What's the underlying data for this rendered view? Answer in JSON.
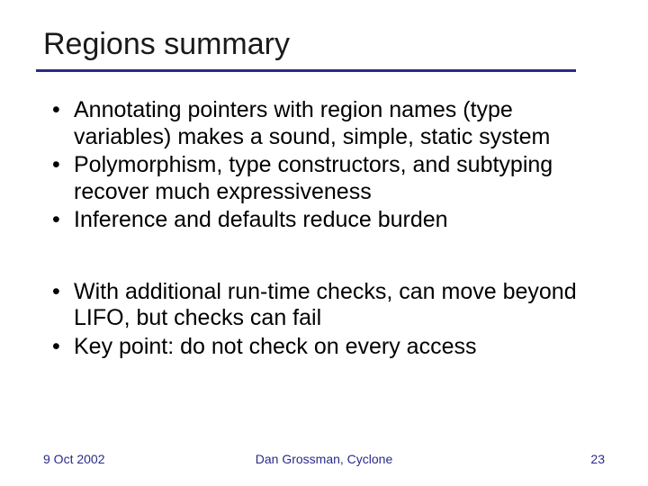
{
  "title": "Regions summary",
  "bullets_a": [
    "Annotating pointers with region names (type variables) makes a sound, simple, static system",
    "Polymorphism, type constructors, and subtyping recover much expressiveness",
    "Inference and defaults reduce burden"
  ],
  "bullets_b": [
    "With additional run-time checks, can move beyond LIFO, but checks can fail",
    "Key point: do not check on every access"
  ],
  "footer": {
    "date": "9 Oct 2002",
    "author": "Dan Grossman, Cyclone",
    "page": "23"
  }
}
